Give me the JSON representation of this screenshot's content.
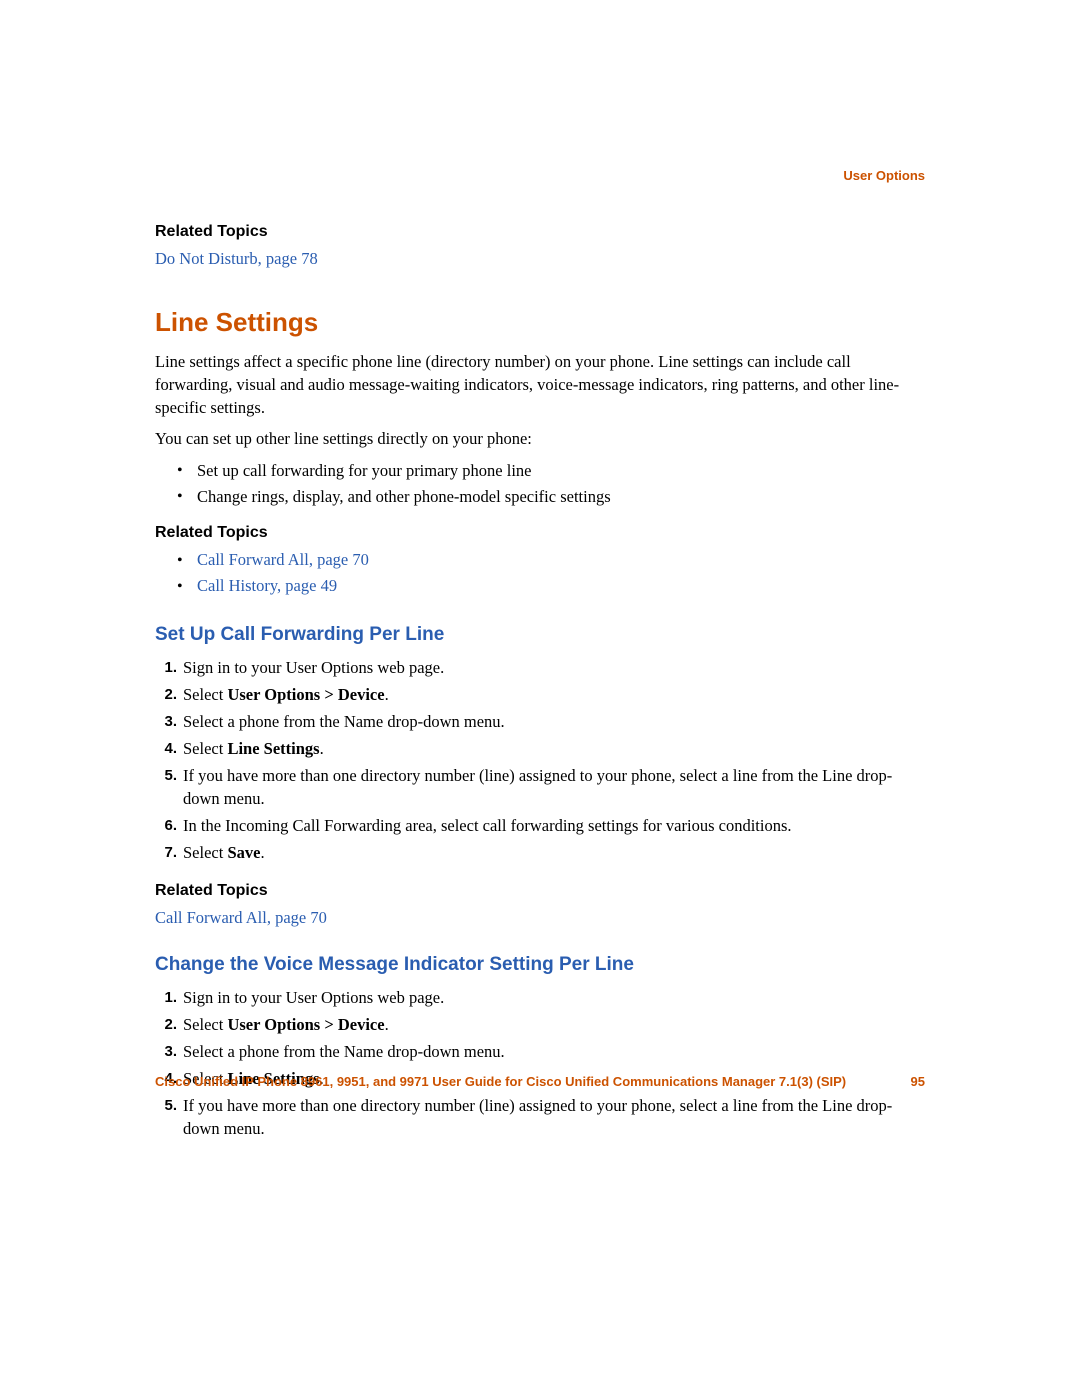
{
  "chapter_label": "User Options",
  "top_related": {
    "heading": "Related Topics",
    "link": "Do Not Disturb, page 78"
  },
  "section": {
    "title": "Line Settings",
    "para1": "Line settings affect a specific phone line (directory number) on your phone. Line settings can include call forwarding, visual and audio message-waiting indicators, voice-message indicators, ring patterns, and other line-specific settings.",
    "para2": "You can set up other line settings directly on your phone:",
    "bullets": [
      "Set up call forwarding for your primary phone line",
      "Change rings, display, and other phone-model specific settings"
    ],
    "related": {
      "heading": "Related Topics",
      "links": [
        "Call Forward All, page 70",
        "Call History, page 49"
      ]
    }
  },
  "sub1": {
    "title": "Set Up Call Forwarding Per Line",
    "steps": [
      {
        "pre": "Sign in to your User Options web page."
      },
      {
        "pre": "Select ",
        "b": "User Options > Device",
        "post": "."
      },
      {
        "pre": "Select a phone from the Name drop-down menu."
      },
      {
        "pre": "Select ",
        "b": "Line Settings",
        "post": "."
      },
      {
        "pre": "If you have more than one directory number (line) assigned to your phone, select a line from the Line drop-down menu."
      },
      {
        "pre": "In the Incoming Call Forwarding area, select call forwarding settings for various conditions."
      },
      {
        "pre": "Select ",
        "b": "Save",
        "post": "."
      }
    ],
    "related": {
      "heading": "Related Topics",
      "link": "Call Forward All, page 70"
    }
  },
  "sub2": {
    "title": "Change the Voice Message Indicator Setting Per Line",
    "steps": [
      {
        "pre": "Sign in to your User Options web page."
      },
      {
        "pre": "Select ",
        "b": "User Options > Device",
        "post": "."
      },
      {
        "pre": "Select a phone from the Name drop-down menu."
      },
      {
        "pre": "Select ",
        "b": "Line Settings",
        "post": "."
      },
      {
        "pre": "If you have more than one directory number (line) assigned to your phone, select a line from the Line drop-down menu."
      }
    ]
  },
  "footer": {
    "title": "Cisco Unified IP Phone 8961, 9951, and 9971 User Guide for Cisco Unified Communications Manager 7.1(3) (SIP)",
    "page": "95"
  }
}
